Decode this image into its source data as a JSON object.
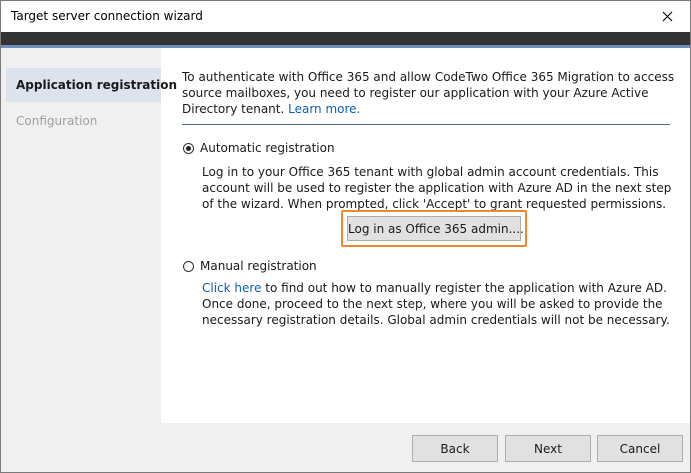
{
  "window": {
    "title": "Target server connection wizard",
    "close_icon": "close-icon"
  },
  "sidebar": {
    "items": [
      {
        "label": "Application registration",
        "active": true
      },
      {
        "label": "Configuration",
        "active": false
      }
    ]
  },
  "content": {
    "intro_text": "To authenticate with Office 365 and allow CodeTwo Office 365 Migration to access source mailboxes, you need to register our application with your Azure Active Directory tenant. ",
    "intro_link": "Learn more.",
    "automatic": {
      "label": "Automatic registration",
      "checked": true,
      "description": "Log in to your Office 365 tenant with global admin account credentials. This account will be used to register the application with Azure AD in the next step of the wizard. When prompted, click 'Accept' to grant requested permissions.",
      "button_label": "Log in as Office 365 admin...."
    },
    "manual": {
      "label": "Manual registration",
      "checked": false,
      "link": "Click here",
      "description": " to find out how to manually register the application with Azure AD. Once done, proceed to the next step, where you will be asked to provide the necessary registration details. Global admin credentials will not be necessary."
    }
  },
  "footer": {
    "back_label": "Back",
    "next_label": "Next",
    "cancel_label": "Cancel"
  },
  "colors": {
    "highlight_border": "#f0882c",
    "link": "#0b5fb8",
    "banner": "#333333",
    "banner_stripe": "#6b8fb8",
    "active_nav": "#dde3ec"
  }
}
